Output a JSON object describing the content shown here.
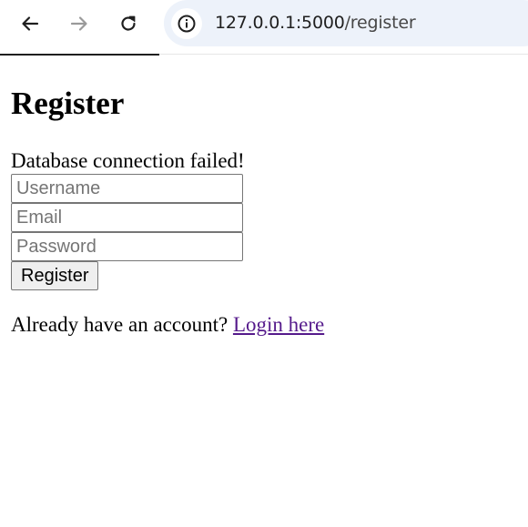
{
  "browser": {
    "url_host": "127.0.0.1:5000",
    "url_path": "/register",
    "icons": {
      "back": "back-arrow-icon",
      "forward": "forward-arrow-icon",
      "reload": "reload-icon",
      "site_info": "info-icon"
    }
  },
  "page": {
    "title": "Register",
    "error_message": "Database connection failed!",
    "form": {
      "username_placeholder": "Username",
      "email_placeholder": "Email",
      "password_placeholder": "Password",
      "submit_label": "Register"
    },
    "footer": {
      "prompt": "Already have an account? ",
      "login_link": "Login here"
    }
  },
  "colors": {
    "link_visited": "#551a8b",
    "omnibox_bg": "#edf2fa"
  }
}
